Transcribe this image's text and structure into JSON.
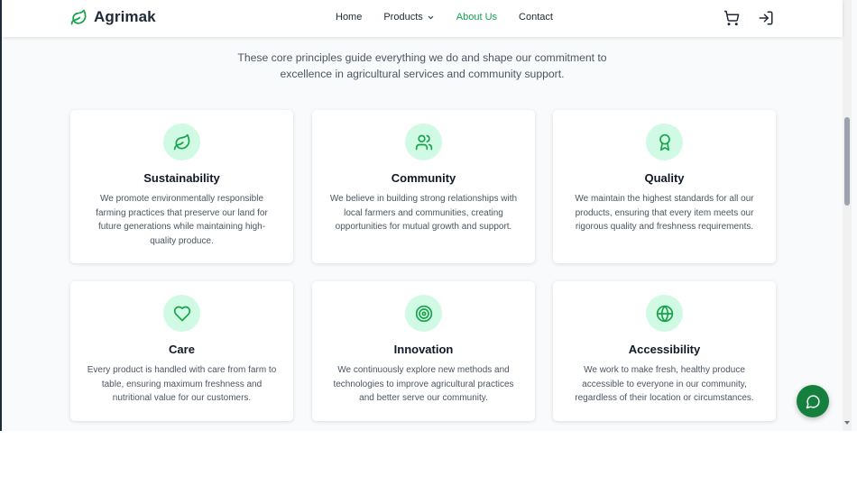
{
  "brand": {
    "name": "Agrimak",
    "icon": "leaf-icon",
    "color": "#16a34a"
  },
  "nav": [
    {
      "label": "Home",
      "active": false
    },
    {
      "label": "Products",
      "active": false,
      "dropdown": true
    },
    {
      "label": "About Us",
      "active": true
    },
    {
      "label": "Contact",
      "active": false
    }
  ],
  "header_icons": [
    "cart-icon",
    "login-icon"
  ],
  "intro": "These core principles guide everything we do and shape our commitment to excellence in agricultural services and community support.",
  "values": [
    {
      "title": "Sustainability",
      "icon": "leaf-icon",
      "description": "We promote environmentally responsible farming practices that preserve our land for future generations while maintaining high-quality produce."
    },
    {
      "title": "Community",
      "icon": "users-icon",
      "description": "We believe in building strong relationships with local farmers and communities, creating opportunities for mutual growth and support."
    },
    {
      "title": "Quality",
      "icon": "award-icon",
      "description": "We maintain the highest standards for all our products, ensuring that every item meets our rigorous quality and freshness requirements."
    },
    {
      "title": "Care",
      "icon": "heart-icon",
      "description": "Every product is handled with care from farm to table, ensuring maximum freshness and nutritional value for our customers."
    },
    {
      "title": "Innovation",
      "icon": "target-icon",
      "description": "We continuously explore new methods and technologies to improve agricultural practices and better serve our community."
    },
    {
      "title": "Accessibility",
      "icon": "globe-icon",
      "description": "We work to make fresh, healthy produce accessible to everyone in our community, regardless of their location or circumstances."
    }
  ],
  "colors": {
    "accent": "#16a34a",
    "icon_bg": "#d1fae5",
    "chat_button": "#15803d"
  },
  "chat_button_icon": "chat-icon"
}
